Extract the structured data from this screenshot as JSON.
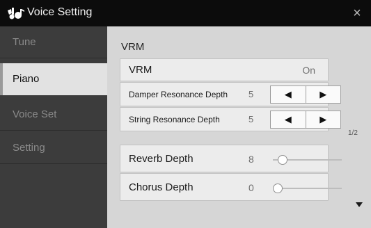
{
  "window": {
    "title": "Voice Setting",
    "close_glyph": "×"
  },
  "sidebar": {
    "tabs": [
      {
        "label": "Tune",
        "active": false
      },
      {
        "label": "Piano",
        "active": true
      },
      {
        "label": "Voice Set",
        "active": false
      },
      {
        "label": "Setting",
        "active": false
      }
    ]
  },
  "main": {
    "section_label": "VRM",
    "vrm": {
      "label": "VRM",
      "value": "On"
    },
    "damper": {
      "label": "Damper Resonance Depth",
      "value": "5"
    },
    "string": {
      "label": "String Resonance Depth",
      "value": "5"
    },
    "reverb": {
      "label": "Reverb Depth",
      "value": "8",
      "level": 0.08
    },
    "chorus": {
      "label": "Chorus Depth",
      "value": "0",
      "level": 0.0
    },
    "page_indicator": "1/2"
  },
  "colors": {
    "titlebar_bg": "#0c0c0c",
    "sidebar_bg": "#3c3c3c",
    "content_bg": "#d6d6d6",
    "row_bg": "#ececec"
  },
  "icons": {
    "title": "voice-instruments-icon",
    "decrement": "triangle-left-icon",
    "increment": "triangle-right-icon",
    "scroll": "triangle-down-icon"
  }
}
